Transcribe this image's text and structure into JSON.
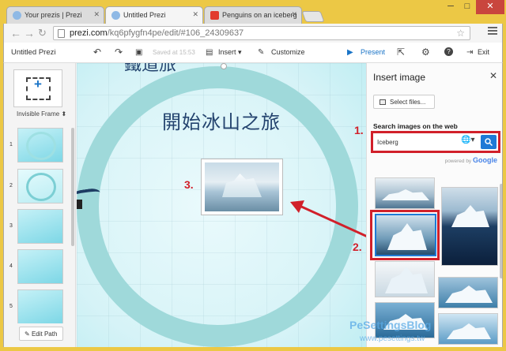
{
  "browser": {
    "tabs": [
      {
        "title": "Your prezis | Prezi",
        "icon": "prezi-icon"
      },
      {
        "title": "Untitled Prezi",
        "icon": "prezi-icon"
      },
      {
        "title": "Penguins on an iceberg",
        "icon": "youtube-icon"
      }
    ],
    "url_host": "prezi.com",
    "url_path": "/kq6pfygfn4pe/edit/#106_24309637"
  },
  "toolbar": {
    "title": "Untitled Prezi",
    "saved": "Saved at 15:53",
    "insert": "Insert",
    "customize": "Customize",
    "present": "Present",
    "exit": "Exit"
  },
  "sidebar": {
    "frame_type": "Invisible Frame",
    "thumbnails": [
      "1",
      "2",
      "3",
      "4",
      "5"
    ],
    "edit_path": "Edit Path"
  },
  "canvas": {
    "title": "開始冰山之旅",
    "top_text": "鐵道旅"
  },
  "panel": {
    "title": "Insert image",
    "select_files": "Select files...",
    "search_label": "Search images on the web",
    "search_value": "Iceberg",
    "powered_by": "powered by",
    "google": "Google"
  },
  "annotations": {
    "a1": "1.",
    "a2": "2.",
    "a3": "3."
  },
  "watermark": {
    "line1": "PeSettingsBlog",
    "line2": "www.pesettings.tw"
  },
  "colors": {
    "annotation_red": "#d1202a",
    "accent_blue": "#1f7ad6",
    "title_navy": "#23436e",
    "ring_teal": "#9fd9da",
    "window_frame": "#ecc845"
  }
}
